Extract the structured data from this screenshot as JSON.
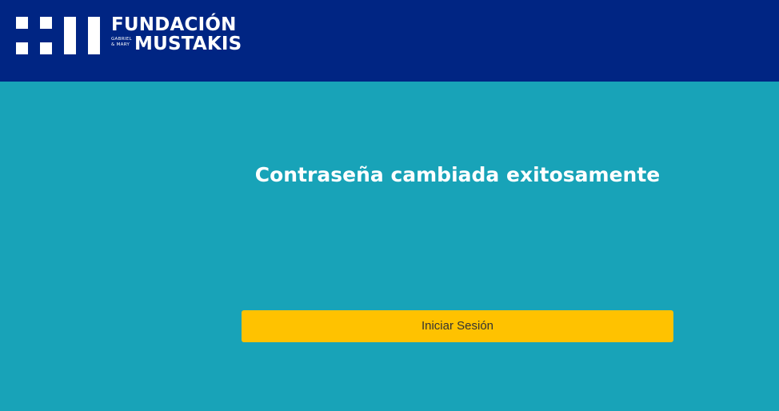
{
  "header": {
    "logo": {
      "line1": "FUNDACIÓN",
      "line2": "MUSTAKIS",
      "sub_top": "GABRIEL",
      "sub_bottom": "& MARY"
    }
  },
  "main": {
    "title": "Contraseña cambiada exitosamente",
    "login_button_label": "Iniciar Sesión"
  },
  "colors": {
    "header_bg": "#002583",
    "main_bg": "#18a3b8",
    "button_bg": "#ffc200"
  }
}
